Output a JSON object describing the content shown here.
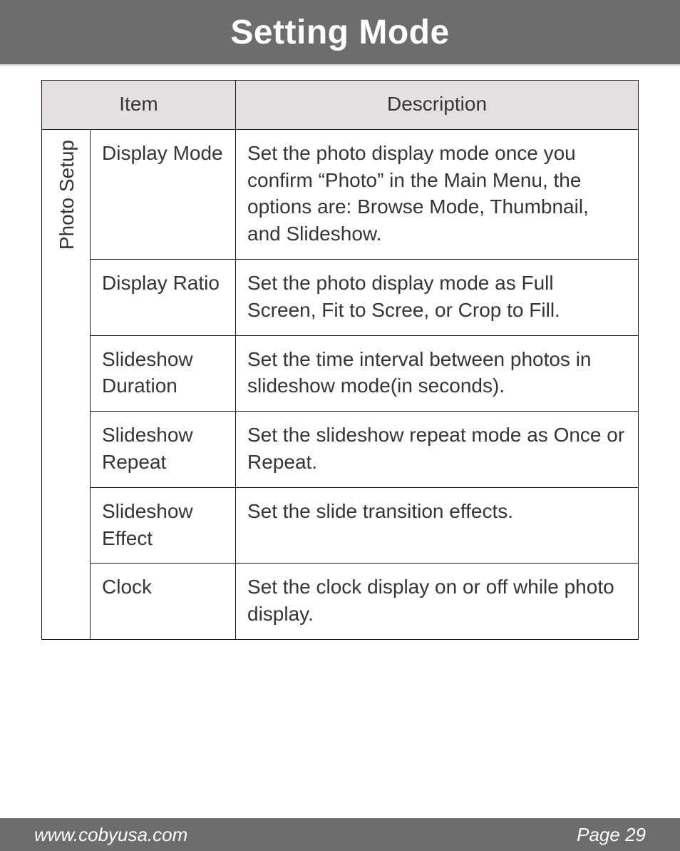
{
  "header": {
    "title": "Setting Mode"
  },
  "table": {
    "headers": {
      "item": "Item",
      "description": "Description"
    },
    "category": "Photo Setup",
    "rows": [
      {
        "item": "Display Mode",
        "desc": "Set the photo display mode once you confirm “Photo” in the Main Menu, the options are: Browse Mode, Thumbnail, and Slideshow."
      },
      {
        "item": "Display Ratio",
        "desc": "Set the photo display mode as Full Screen, Fit to Scree, or Crop to Fill."
      },
      {
        "item": "Slideshow Duration",
        "desc": "Set the time interval between photos in slide­show mode(in seconds)."
      },
      {
        "item": "Slideshow Repeat",
        "desc": "Set the slideshow repeat mode as Once or Repeat."
      },
      {
        "item": "Slideshow Effect",
        "desc": "Set the slide transition effects."
      },
      {
        "item": "Clock",
        "desc": "Set the clock display on or off while photo display."
      }
    ]
  },
  "footer": {
    "site": "www.cobyusa.com",
    "page": "Page 29"
  }
}
